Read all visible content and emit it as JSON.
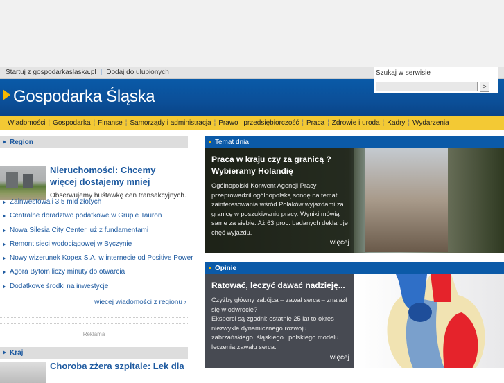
{
  "topbar": {
    "start": "Startuj z gospodarkaslaska.pl",
    "sep": "|",
    "favorites": "Dodaj do ulubionych"
  },
  "logo": "Gospodarka Śląska",
  "search": {
    "label": "Szukaj w serwisie",
    "button": ">",
    "value": ""
  },
  "nav": [
    "Wiadomości",
    "Gospodarka",
    "Finanse",
    "Samorządy i administracja",
    "Prawo i przedsiębiorczość",
    "Praca",
    "Zdrowie i uroda",
    "Kadry",
    "Wydarzenia"
  ],
  "region": {
    "title": "Region",
    "featured": {
      "headline": "Nieruchomości: Chcemy więcej dostajemy mniej",
      "lead": "Obserwujemy huśtawkę cen transakcyjnych."
    },
    "items": [
      "Zainwestowali 3,5 mld złotych",
      "Centralne doradztwo podatkowe w Grupie Tauron",
      "Nowa Silesia City Center już z fundamentami",
      "Remont sieci wodociągowej w Byczynie",
      "Nowy wizerunek Kopex S.A. w internecie od Positive Power",
      "Agora Bytom liczy minuty do otwarcia",
      "Dodatkowe środki na inwestycje"
    ],
    "more": "więcej wiadomości z regionu ›"
  },
  "ad": "Reklama",
  "kraj": {
    "title": "Kraj",
    "headline": "Choroba zżera szpitale: Lek dla"
  },
  "temat": {
    "title": "Temat dnia",
    "headline": "Praca w kraju czy za granicą ? Wybieramy Holandię",
    "body": "Ogólnopolski Konwent Agencji Pracy przeprowadził ogólnopolską sondę na temat zainteresowania wśród Polaków wyjazdami za granicę w poszukiwaniu pracy. Wyniki mówią same za siebie. Aż 63 proc. badanych deklaruje chęć wyjazdu.",
    "more": "więcej"
  },
  "opinie": {
    "title": "Opinie",
    "headline": "Ratować, leczyć dawać nadzieję...",
    "body1": "Czyżby główny zabójca – zawał serca – znalazł się w odwrocie?",
    "body2": "Eksperci są zgodni: ostatnie 25 lat to okres niezwykle dynamicznego rozwoju zabrzańskiego, śląskiego i polskiego modelu leczenia zawału serca.",
    "more": "więcej"
  },
  "colors": {
    "blue": "#0b5aa8",
    "yellow": "#f3c934",
    "link": "#1e5aa0"
  }
}
